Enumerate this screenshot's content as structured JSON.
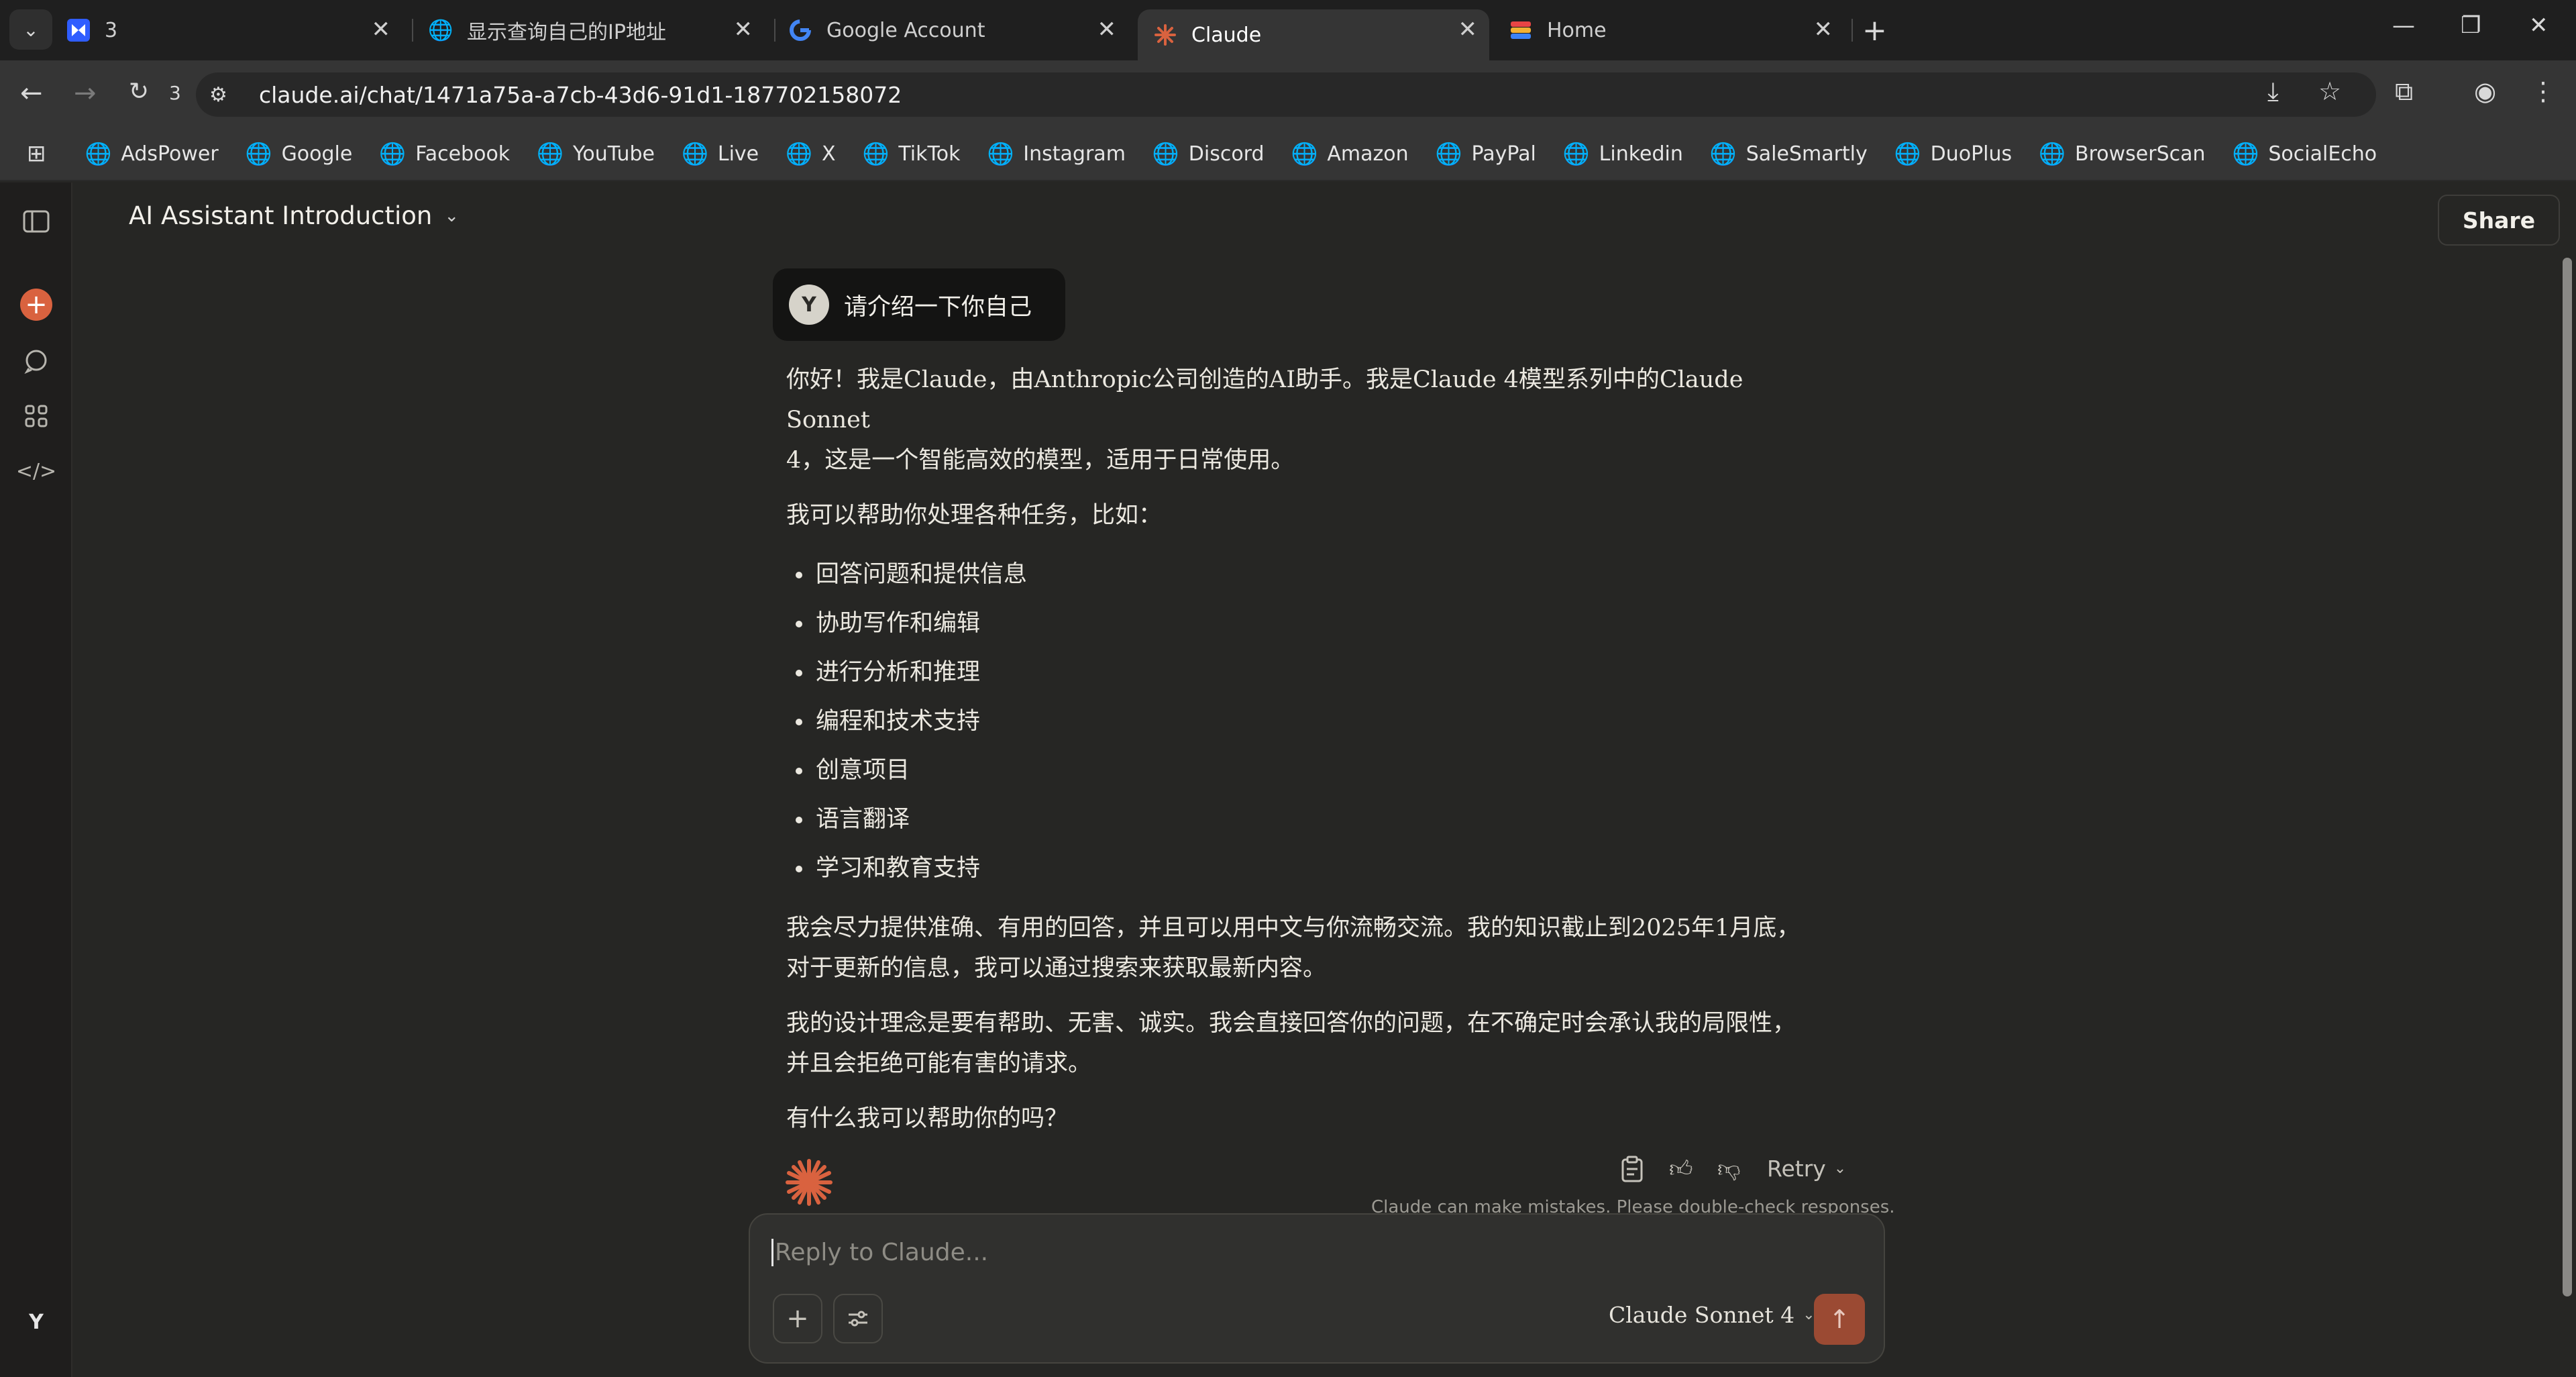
{
  "browser": {
    "tabs": [
      {
        "title": "3",
        "icon": "adspower-icon"
      },
      {
        "title": "显示查询自己的IP地址",
        "icon": "globe-icon"
      },
      {
        "title": "Google Account",
        "icon": "google-icon"
      },
      {
        "title": "Claude",
        "icon": "claude-icon",
        "active": true
      },
      {
        "title": "Home",
        "icon": "app-icon"
      }
    ],
    "reload_count": "3",
    "url": "claude.ai/chat/1471a75a-a7cb-43d6-91d1-187702158072",
    "bookmarks": [
      "AdsPower",
      "Google",
      "Facebook",
      "YouTube",
      "Live",
      "X",
      "TikTok",
      "Instagram",
      "Discord",
      "Amazon",
      "PayPal",
      "Linkedin",
      "SaleSmartly",
      "DuoPlus",
      "BrowserScan",
      "SocialEcho"
    ]
  },
  "sidebar": {
    "user_initial": "Y"
  },
  "header": {
    "title": "AI Assistant Introduction",
    "share_label": "Share"
  },
  "conversation": {
    "user_initial": "Y",
    "user_message": "请介绍一下你自己",
    "reply": {
      "p1_line1": "你好！我是Claude，由Anthropic公司创造的AI助手。我是Claude 4模型系列中的Claude Sonnet",
      "p1_line2": "4，这是一个智能高效的模型，适用于日常使用。",
      "p2": "我可以帮助你处理各种任务，比如：",
      "items": [
        "回答问题和提供信息",
        "协助写作和编辑",
        "进行分析和推理",
        "编程和技术支持",
        "创意项目",
        "语言翻译",
        "学习和教育支持"
      ],
      "p3_line1": "我会尽力提供准确、有用的回答，并且可以用中文与你流畅交流。我的知识截止到2025年1月底，",
      "p3_line2": "对于更新的信息，我可以通过搜索来获取最新内容。",
      "p4_line1": "我的设计理念是要有帮助、无害、诚实。我会直接回答你的问题，在不确定时会承认我的局限性，",
      "p4_line2": "并且会拒绝可能有害的请求。",
      "p5": "有什么我可以帮助你的吗？"
    },
    "retry_label": "Retry",
    "disclaimer": "Claude can make mistakes. Please double-check responses."
  },
  "composer": {
    "placeholder": "Reply to Claude...",
    "model_label": "Claude Sonnet 4"
  },
  "colors": {
    "accent": "#d9623f",
    "send_button": "#9b4a33",
    "background": "#262624"
  }
}
